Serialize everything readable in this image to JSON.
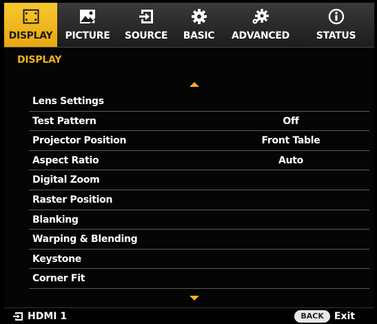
{
  "tabs": [
    {
      "label": "DISPLAY",
      "icon": "display-icon",
      "active": true
    },
    {
      "label": "PICTURE",
      "icon": "picture-icon",
      "active": false
    },
    {
      "label": "SOURCE",
      "icon": "source-icon",
      "active": false
    },
    {
      "label": "BASIC",
      "icon": "gear-icon",
      "active": false
    },
    {
      "label": "ADVANCED",
      "icon": "advanced-gear-icon",
      "active": false
    },
    {
      "label": "STATUS",
      "icon": "info-icon",
      "active": false
    }
  ],
  "section_title": "DISPLAY",
  "menu": [
    {
      "label": "Lens Settings",
      "value": ""
    },
    {
      "label": "Test Pattern",
      "value": "Off"
    },
    {
      "label": "Projector Position",
      "value": "Front Table"
    },
    {
      "label": "Aspect Ratio",
      "value": "Auto"
    },
    {
      "label": "Digital Zoom",
      "value": ""
    },
    {
      "label": "Raster Position",
      "value": ""
    },
    {
      "label": "Blanking",
      "value": ""
    },
    {
      "label": "Warping & Blending",
      "value": ""
    },
    {
      "label": "Keystone",
      "value": ""
    },
    {
      "label": "Corner Fit",
      "value": ""
    }
  ],
  "footer": {
    "source": "HDMI 1",
    "back_label": "BACK",
    "exit_label": "Exit"
  },
  "colors": {
    "accent": "#f2b21c",
    "active_tab": "#efb41f",
    "background": "#000000",
    "divider": "#5a5a5a"
  }
}
